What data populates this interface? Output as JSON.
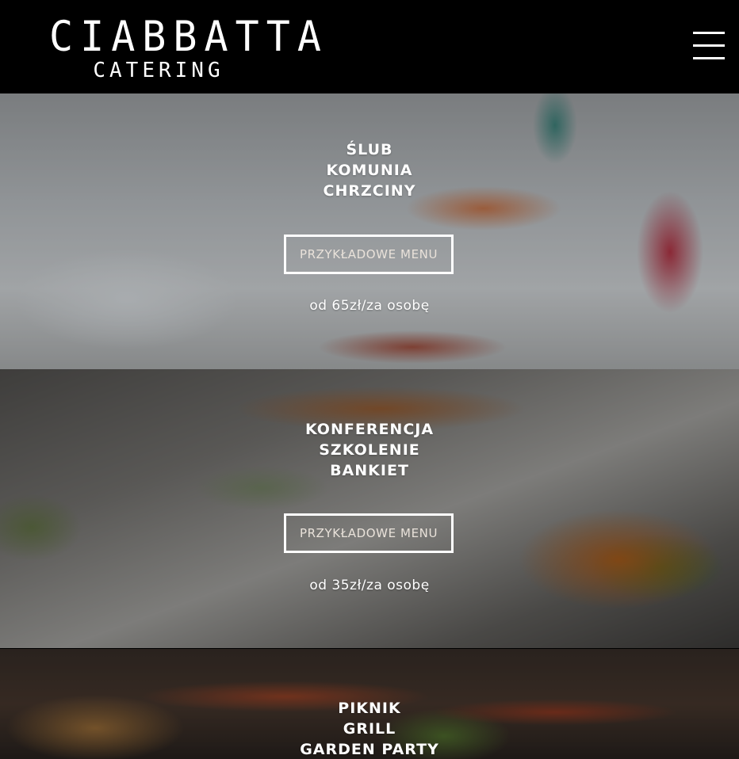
{
  "header": {
    "logo_main": "CIABBATTA",
    "logo_sub": "CATERING"
  },
  "sections": [
    {
      "lines": [
        "ŚLUB",
        "KOMUNIA",
        "CHRZCINY"
      ],
      "button_label": "PRZYKŁADOWE MENU",
      "price": "od 65zł/za osobę"
    },
    {
      "lines": [
        "KONFERENCJA",
        "SZKOLENIE",
        "BANKIET"
      ],
      "button_label": "PRZYKŁADOWE MENU",
      "price": "od 35zł/za osobę"
    },
    {
      "lines": [
        "PIKNIK",
        "GRILL",
        "GARDEN PARTY"
      ]
    }
  ]
}
